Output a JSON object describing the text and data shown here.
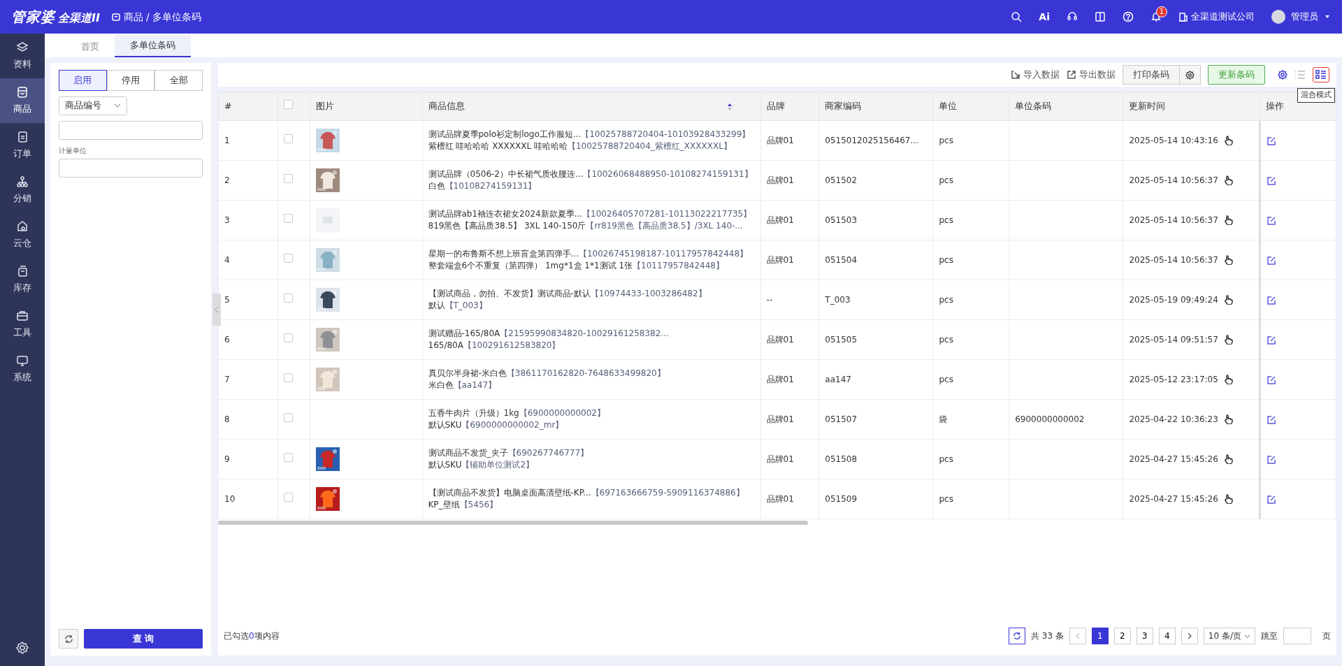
{
  "header": {
    "logo_main": "管家婆",
    "logo_sub": "全渠道II",
    "breadcrumb": [
      "商品",
      "多单位条码"
    ],
    "breadcrumb_separator": "/",
    "ai_label": "Ai",
    "notifications": "1",
    "company": "全渠道测试公司",
    "user": "管理员"
  },
  "sidebar": {
    "items": [
      {
        "label": "资料",
        "selected": false
      },
      {
        "label": "商品",
        "selected": true
      },
      {
        "label": "订单",
        "selected": false
      },
      {
        "label": "分销",
        "selected": false
      },
      {
        "label": "云仓",
        "selected": false
      },
      {
        "label": "库存",
        "selected": false
      },
      {
        "label": "工具",
        "selected": false
      },
      {
        "label": "系统",
        "selected": false
      }
    ]
  },
  "tabs": [
    {
      "label": "首页",
      "selected": false
    },
    {
      "label": "多单位条码",
      "selected": true
    }
  ],
  "filters": {
    "status": [
      {
        "label": "启用",
        "selected": true
      },
      {
        "label": "停用",
        "selected": false
      },
      {
        "label": "全部",
        "selected": false
      }
    ],
    "field_select": "商品编号",
    "unit_label": "计量单位",
    "query": "查 询"
  },
  "toolbar": {
    "import": "导入数据",
    "export": "导出数据",
    "print": "打印条码",
    "update": "更新条码",
    "tooltip": "混合模式"
  },
  "table": {
    "select_all_checked": false,
    "columns": [
      "#",
      "图片",
      "商品信息",
      "品牌",
      "商家编码",
      "单位",
      "单位条码",
      "更新时间",
      "操作"
    ],
    "rows": [
      {
        "no": "1",
        "checked": false,
        "image": {
          "kind": "picture"
        },
        "info": [
          [
            "测试品牌夏季polo衫定制logo工作服短...",
            "【10025788720404-10103928433299】"
          ],
          [
            "紫檀红 哇哈哈哈 XXXXXXL 哇哈哈哈",
            "【10025788720404_紫檀红_XXXXXXL】"
          ]
        ],
        "brand": "品牌01",
        "code": "0515012025156467...",
        "unit": "pcs",
        "barcode": "",
        "time": "2025-05-14 10:43:16"
      },
      {
        "no": "2",
        "checked": false,
        "image": {
          "kind": "picture"
        },
        "info": [
          [
            "测试品牌（0506-2）中长裙气质收腰连...",
            "【10026068488950-10108274159131】"
          ],
          [
            "白色",
            "【10108274159131】"
          ]
        ],
        "brand": "品牌01",
        "code": "051502",
        "unit": "pcs",
        "barcode": "",
        "time": "2025-05-14 10:56:37"
      },
      {
        "no": "3",
        "checked": false,
        "image": {
          "kind": "placeholder"
        },
        "info": [
          [
            "测试品牌ab1袖连衣裙女2024新款夏季...",
            "【10026405707281-10113022217735】"
          ],
          [
            "819黑色【高品质38.5】 3XL 140-150斤",
            "【rr819黑色【高品质38.5】/3XL 140-..."
          ]
        ],
        "brand": "品牌01",
        "code": "051503",
        "unit": "pcs",
        "barcode": "",
        "time": "2025-05-14 10:56:37"
      },
      {
        "no": "4",
        "checked": false,
        "image": {
          "kind": "picture"
        },
        "info": [
          [
            "星期一的布鲁斯不想上班盲盒第四弹手...",
            "【10026745198187-10117957842448】"
          ],
          [
            "整套端盒6个不重复（第四弹） 1mg*1盒 1*1测试 1张",
            "【10117957842448】"
          ]
        ],
        "brand": "品牌01",
        "code": "051504",
        "unit": "pcs",
        "barcode": "",
        "time": "2025-05-14 10:56:37"
      },
      {
        "no": "5",
        "checked": false,
        "image": {
          "kind": "picture"
        },
        "info": [
          [
            "【测试商品，勿拍、不发货】测试商品-默认",
            "【10974433-1003286482】"
          ],
          [
            "默认",
            "【T_003】"
          ]
        ],
        "brand": "--",
        "code": "T_003",
        "unit": "pcs",
        "barcode": "",
        "time": "2025-05-19 09:49:24"
      },
      {
        "no": "6",
        "checked": false,
        "image": {
          "kind": "picture"
        },
        "info": [
          [
            "测试赠品-165/80A",
            "【21595990834820-10029161258382..."
          ],
          [
            "165/80A",
            "【100291612583820】"
          ]
        ],
        "brand": "品牌01",
        "code": "051505",
        "unit": "pcs",
        "barcode": "",
        "time": "2025-05-14 09:51:57"
      },
      {
        "no": "7",
        "checked": false,
        "image": {
          "kind": "picture"
        },
        "info": [
          [
            "真贝尔半身裙-米白色",
            "【3861170162820-7648633499820】"
          ],
          [
            "米白色",
            "【aa147】"
          ]
        ],
        "brand": "品牌01",
        "code": "aa147",
        "unit": "pcs",
        "barcode": "",
        "time": "2025-05-12 23:17:05"
      },
      {
        "no": "8",
        "checked": false,
        "info": [
          [
            "五香牛肉片（升级）1kg",
            "【6900000000002】"
          ],
          [
            "默认SKU",
            "【6900000000002_mr】"
          ]
        ],
        "brand": "品牌01",
        "code": "051507",
        "unit": "袋",
        "barcode": "6900000000002",
        "time": "2025-04-22 10:36:23"
      },
      {
        "no": "9",
        "checked": false,
        "image": {
          "kind": "picture"
        },
        "info": [
          [
            "测试商品不发货_夹子",
            "【690267746777】"
          ],
          [
            "默认SKU",
            "【辅助单位测试2】"
          ]
        ],
        "brand": "品牌01",
        "code": "051508",
        "unit": "pcs",
        "barcode": "",
        "time": "2025-04-27 15:45:26"
      },
      {
        "no": "10",
        "checked": false,
        "image": {
          "kind": "picture"
        },
        "info": [
          [
            "【测试商品不发货】电脑桌面高清壁纸-KP...",
            "【697163666759-5909116374886】"
          ],
          [
            "KP_壁纸",
            "【5456】"
          ]
        ],
        "brand": "品牌01",
        "code": "051509",
        "unit": "pcs",
        "barcode": "",
        "time": "2025-04-27 15:45:26"
      }
    ]
  },
  "footer": {
    "selected_prefix": "已勾选",
    "selected_count": "0",
    "selected_suffix": "项内容",
    "total": "共 33 条",
    "pages": [
      {
        "label": "1",
        "selected": true
      },
      {
        "label": "2",
        "selected": false
      },
      {
        "label": "3",
        "selected": false
      },
      {
        "label": "4",
        "selected": false
      }
    ],
    "page_size": "10 条/页",
    "jump": "跳至",
    "page_unit": "页"
  }
}
